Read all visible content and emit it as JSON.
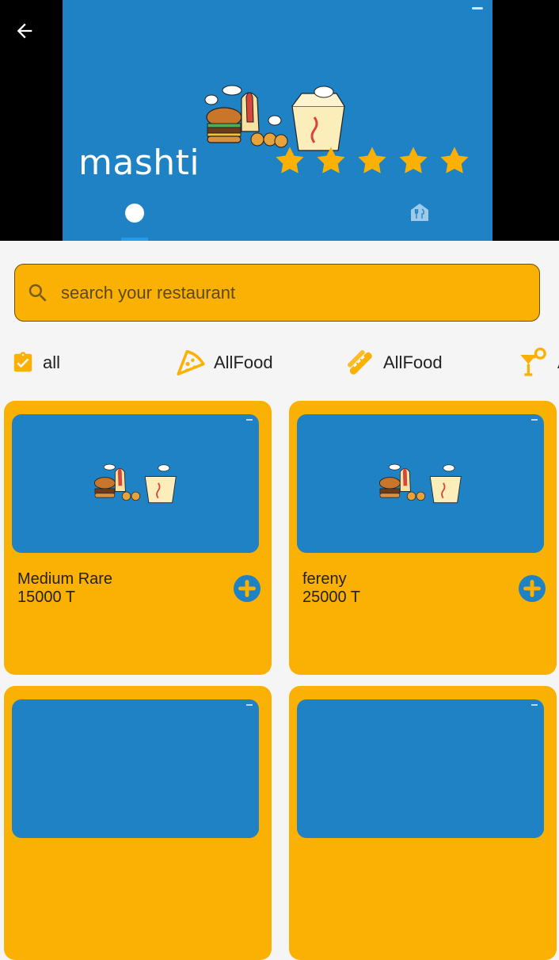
{
  "header": {
    "restaurant_name": "mashti",
    "rating_stars": 5,
    "back_icon": "arrow-left-icon",
    "tabs": [
      {
        "icon": "info-dot-icon",
        "active": true
      },
      {
        "icon": "menu-icon",
        "active": false
      }
    ]
  },
  "search": {
    "placeholder": "search your restaurant",
    "icon": "search-icon"
  },
  "categories": [
    {
      "label": "all",
      "icon": "clipboard-check-icon"
    },
    {
      "label": "AllFood",
      "icon": "pizza-icon"
    },
    {
      "label": "AllFood",
      "icon": "hotdog-icon"
    },
    {
      "label": "A",
      "icon": "cocktail-icon"
    }
  ],
  "products": [
    {
      "name": "Medium Rare",
      "price": "15000 T"
    },
    {
      "name": "fereny",
      "price": "25000 T"
    }
  ],
  "colors": {
    "accent": "#fbb103",
    "hero_blue": "#1e82c4",
    "background": "#f5f5f5"
  }
}
